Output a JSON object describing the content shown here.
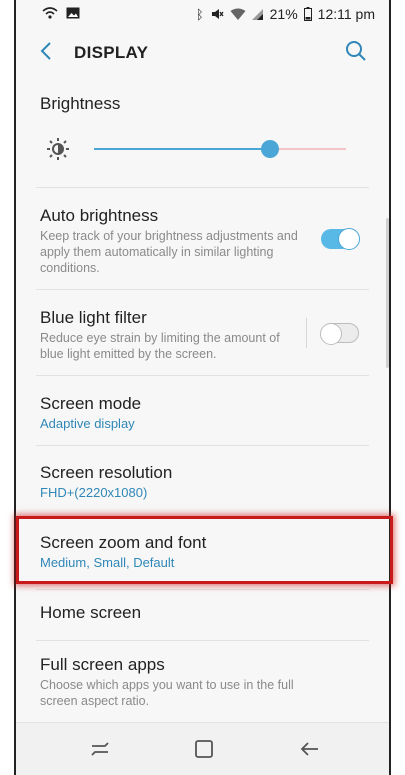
{
  "status_bar": {
    "icons_left": [
      "wifi-calling-icon",
      "image-icon"
    ],
    "icons_right": [
      "bluetooth-icon",
      "mute-icon",
      "wifi-icon",
      "signal-icon"
    ],
    "battery": "21%",
    "time": "12:11 pm"
  },
  "toolbar": {
    "title": "DISPLAY"
  },
  "brightness": {
    "title": "Brightness",
    "level": 0.7
  },
  "auto_brightness": {
    "title": "Auto brightness",
    "desc": "Keep track of your brightness adjustments and apply them automatically in similar lighting conditions.",
    "enabled": true
  },
  "blue_light": {
    "title": "Blue light filter",
    "desc": "Reduce eye strain by limiting the amount of blue light emitted by the screen.",
    "enabled": false
  },
  "screen_mode": {
    "title": "Screen mode",
    "value": "Adaptive display"
  },
  "screen_resolution": {
    "title": "Screen resolution",
    "value": "FHD+(2220x1080)"
  },
  "screen_zoom": {
    "title": "Screen zoom and font",
    "value": "Medium, Small, Default"
  },
  "home_screen": {
    "title": "Home screen"
  },
  "full_screen_apps": {
    "title": "Full screen apps",
    "desc": "Choose which apps you want to use in the full screen aspect ratio."
  },
  "colors": {
    "accent": "#2f87b8",
    "toggle_on": "#58b8e6",
    "highlight": "#c81a1a"
  }
}
